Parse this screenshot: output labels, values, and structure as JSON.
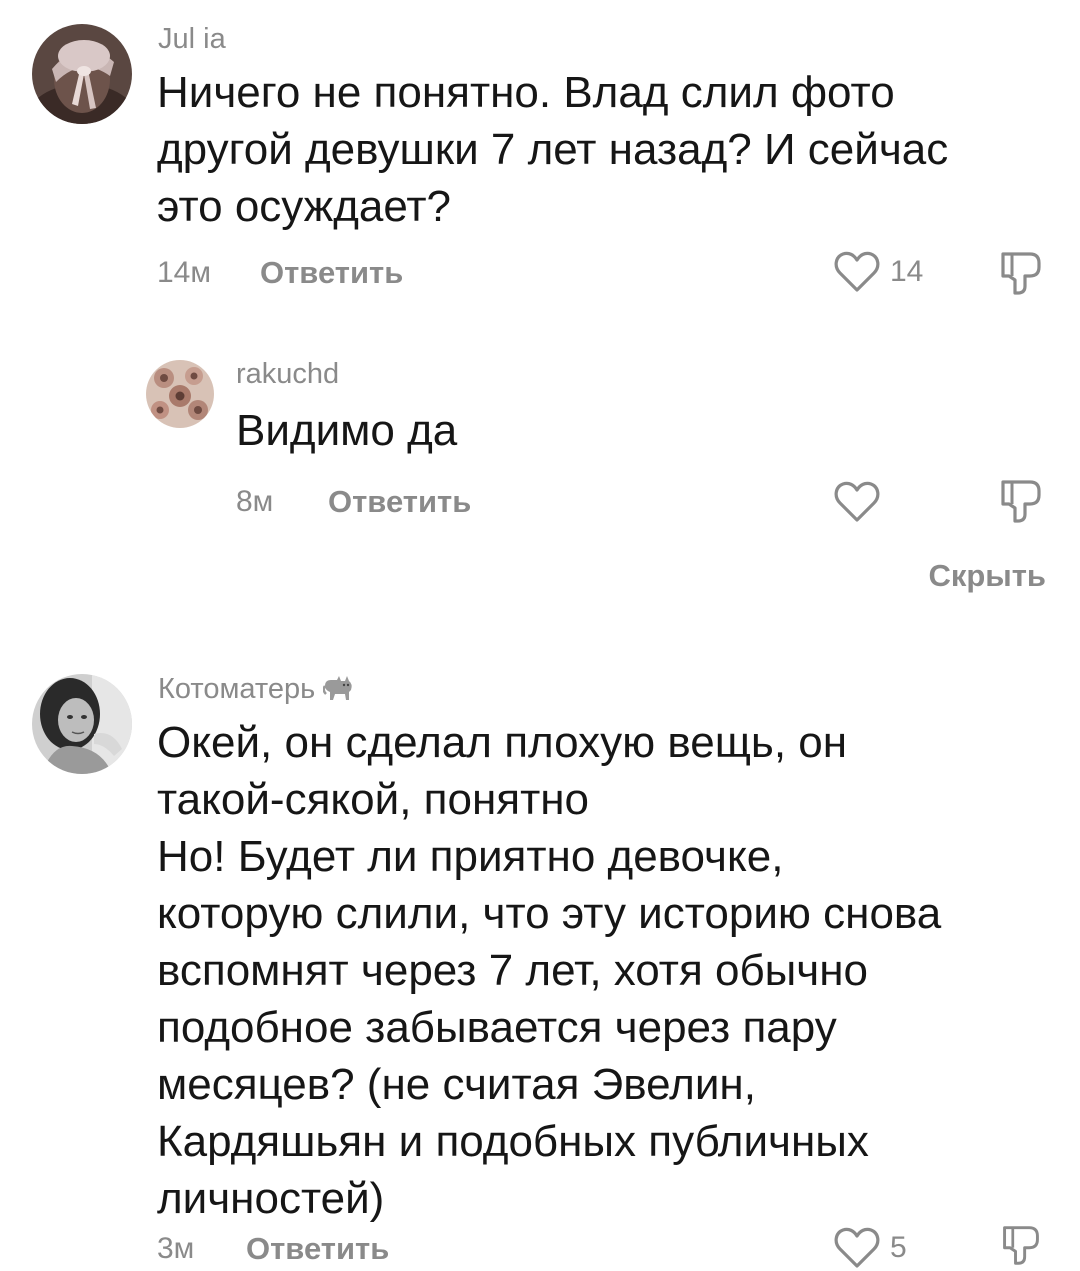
{
  "comments": [
    {
      "username": "Jul ia",
      "text": "Ничего не понятно. Влад слил фото\nдругой девушки 7 лет назад? И сейчас\nэто осуждает?",
      "time": "14м",
      "reply_label": "Ответить",
      "likes": "14",
      "avatar_icon": "avatar-photo-girl-with-bow"
    },
    {
      "username": "rakuchd",
      "text": "Видимо да",
      "time": "8м",
      "reply_label": "Ответить",
      "likes": "",
      "avatar_icon": "avatar-photo-pattern"
    },
    {
      "username": "Котоматерь",
      "text": "Окей, он сделал плохую вещь, он\nтакой-сякой, понятно\nНо! Будет ли приятно девочке,\nкоторую слили, что эту историю снова\nвспомнят через 7 лет, хотя обычно\nподобное забывается через пару\nмесяцев? (не считая Эвелин,\nКардяшьян и подобных публичных\nличностей)",
      "time": "3м",
      "reply_label": "Ответить",
      "likes": "5",
      "avatar_icon": "avatar-photo-girl-bw"
    }
  ],
  "hide_replies_label": "Скрыть",
  "icons": {
    "like": "heart-outline-icon",
    "dislike": "thumbs-down-outline-icon",
    "username_badge": "cat-emoji-icon"
  },
  "colors": {
    "text": "#161616",
    "muted": "#8a8a8a",
    "background": "#ffffff"
  }
}
